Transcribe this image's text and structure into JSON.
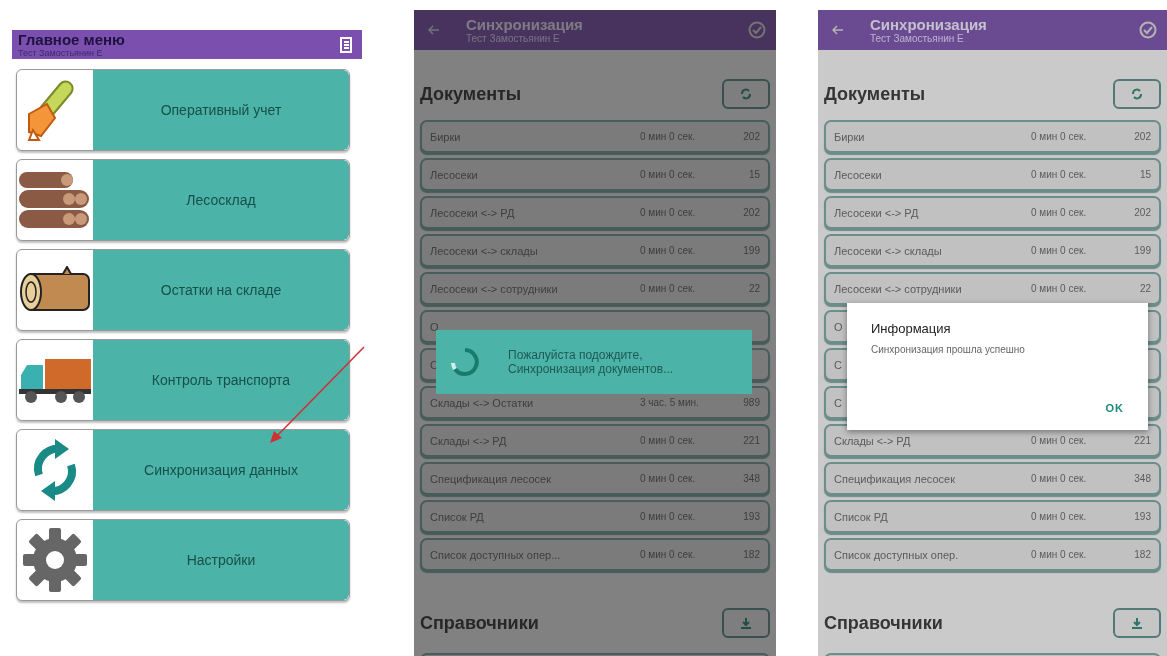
{
  "main_menu": {
    "title": "Главное меню",
    "subtitle": "Тест Замостьянин Е",
    "items": [
      {
        "label": "Оперативный учет",
        "kind": "chainsaw"
      },
      {
        "label": "Лесосклад",
        "kind": "logs"
      },
      {
        "label": "Остатки на складе",
        "kind": "log"
      },
      {
        "label": "Контроль транспорта",
        "kind": "truck"
      },
      {
        "label": "Синхронизация данных",
        "kind": "sync"
      },
      {
        "label": "Настройки",
        "kind": "gear"
      }
    ]
  },
  "sync_screens": [
    {
      "title": "Синхронизация",
      "subtitle": "Тест Замостьянин Е",
      "section": "Документы",
      "section2": "Справочники",
      "rows": [
        {
          "name": "Бирки",
          "time": "0 мин 0 сек.",
          "count": "202"
        },
        {
          "name": "Лесосеки",
          "time": "0 мин 0 сек.",
          "count": "15"
        },
        {
          "name": "Лесосеки <-> РД",
          "time": "0 мин 0 сек.",
          "count": "202"
        },
        {
          "name": "Лесосеки <-> склады",
          "time": "0 мин 0 сек.",
          "count": "199"
        },
        {
          "name": "Лесосеки <-> сотрудники",
          "time": "0 мин 0 сек.",
          "count": "22"
        },
        {
          "name": "О"
        },
        {
          "name": "С"
        },
        {
          "name": "Склады <-> Остатки",
          "time": "3 час. 5 мин.",
          "count": "989"
        },
        {
          "name": "Склады <-> РД",
          "time": "0 мин 0 сек.",
          "count": "221"
        },
        {
          "name": "Спецификация лесосек",
          "time": "0 мин 0 сек.",
          "count": "348"
        },
        {
          "name": "Список РД",
          "time": "0 мин 0 сек.",
          "count": "193"
        },
        {
          "name": "Список доступных опер...",
          "time": "0 мин 0 сек.",
          "count": "182"
        }
      ],
      "dialog": {
        "kind": "progress",
        "lines": [
          "Пожалуйста подождите,",
          "Синхронизация документов..."
        ]
      }
    },
    {
      "title": "Синхронизация",
      "subtitle": "Тест Замостьянин Е",
      "section": "Документы",
      "section2": "Справочники",
      "rows": [
        {
          "name": "Бирки",
          "time": "0 мин 0 сек.",
          "count": "202"
        },
        {
          "name": "Лесосеки",
          "time": "0 мин 0 сек.",
          "count": "15"
        },
        {
          "name": "Лесосеки <-> РД",
          "time": "0 мин 0 сек.",
          "count": "202"
        },
        {
          "name": "Лесосеки <-> склады",
          "time": "0 мин 0 сек.",
          "count": "199"
        },
        {
          "name": "Лесосеки <-> сотрудники",
          "time": "0 мин 0 сек.",
          "count": "22"
        },
        {
          "name": "О"
        },
        {
          "name": "С"
        },
        {
          "name": "С"
        },
        {
          "name": "Склады <-> РД",
          "time": "0 мин 0 сек.",
          "count": "221"
        },
        {
          "name": "Спецификация лесосек",
          "time": "0 мин 0 сек.",
          "count": "348"
        },
        {
          "name": "Список РД",
          "time": "0 мин 0 сек.",
          "count": "193"
        },
        {
          "name": "Список доступных опер.",
          "time": "0 мин 0 сек.",
          "count": "182"
        }
      ],
      "dialog": {
        "kind": "alert",
        "title": "Информация",
        "lines": [
          "Синхронизация прошла успешно"
        ],
        "button": "OK"
      }
    }
  ]
}
